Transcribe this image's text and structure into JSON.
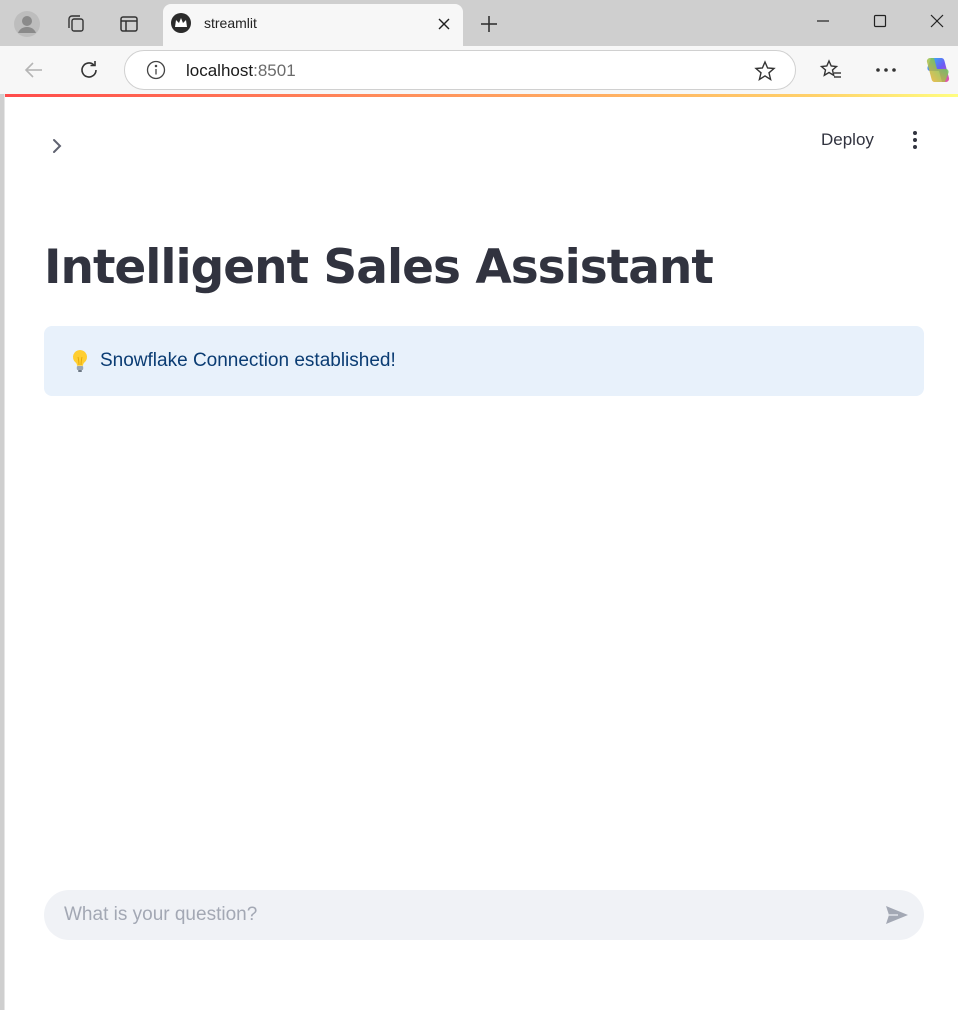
{
  "browser": {
    "tab_title": "streamlit",
    "url_host": "localhost",
    "url_port": ":8501"
  },
  "app": {
    "deploy_label": "Deploy",
    "title": "Intelligent Sales Assistant",
    "alert": {
      "icon": "lightbulb-icon",
      "text": "Snowflake Connection established!"
    },
    "chat": {
      "placeholder": "What is your question?",
      "value": ""
    }
  },
  "colors": {
    "accent": "#ff4b4b",
    "title_text": "#31333f",
    "alert_bg": "#e8f1fb",
    "alert_text": "#0b3c73",
    "chat_bg": "#f0f2f6"
  }
}
